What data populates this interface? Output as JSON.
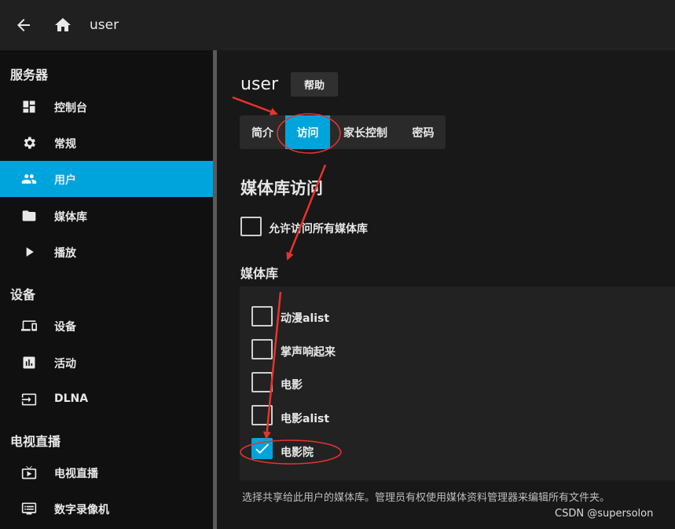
{
  "header": {
    "title": "user"
  },
  "sidebar": {
    "sections": [
      {
        "title": "服务器"
      },
      {
        "title": "设备"
      },
      {
        "title": "电视直播"
      }
    ],
    "items": [
      {
        "label": "控制台",
        "icon": "dashboard-icon"
      },
      {
        "label": "常规",
        "icon": "gear-icon"
      },
      {
        "label": "用户",
        "icon": "people-icon",
        "active": true
      },
      {
        "label": "媒体库",
        "icon": "folder-icon"
      },
      {
        "label": "播放",
        "icon": "play-icon"
      },
      {
        "label": "设备",
        "icon": "devices-icon"
      },
      {
        "label": "活动",
        "icon": "chart-icon"
      },
      {
        "label": "DLNA",
        "icon": "input-icon"
      },
      {
        "label": "电视直播",
        "icon": "live-tv-icon"
      },
      {
        "label": "数字录像机",
        "icon": "dvr-icon"
      }
    ]
  },
  "main": {
    "title": "user",
    "help_label": "帮助",
    "tabs": [
      {
        "label": "简介"
      },
      {
        "label": "访问",
        "active": true
      },
      {
        "label": "家长控制"
      },
      {
        "label": "密码"
      }
    ],
    "library_access_heading": "媒体库访问",
    "allow_all_label": "允许访问所有媒体库",
    "allow_all_checked": false,
    "libraries_heading": "媒体库",
    "libraries": [
      {
        "label": "动漫alist",
        "checked": false
      },
      {
        "label": "掌声响起来",
        "checked": false
      },
      {
        "label": "电影",
        "checked": false
      },
      {
        "label": "电影alist",
        "checked": false
      },
      {
        "label": "电影院",
        "checked": true
      }
    ],
    "help_text": "选择共享给此用户的媒体库。管理员有权使用媒体资料管理器来编辑所有文件夹。"
  },
  "watermark": "CSDN @supersolon",
  "colors": {
    "accent": "#00a4dc",
    "annotation": "#e8322d"
  }
}
